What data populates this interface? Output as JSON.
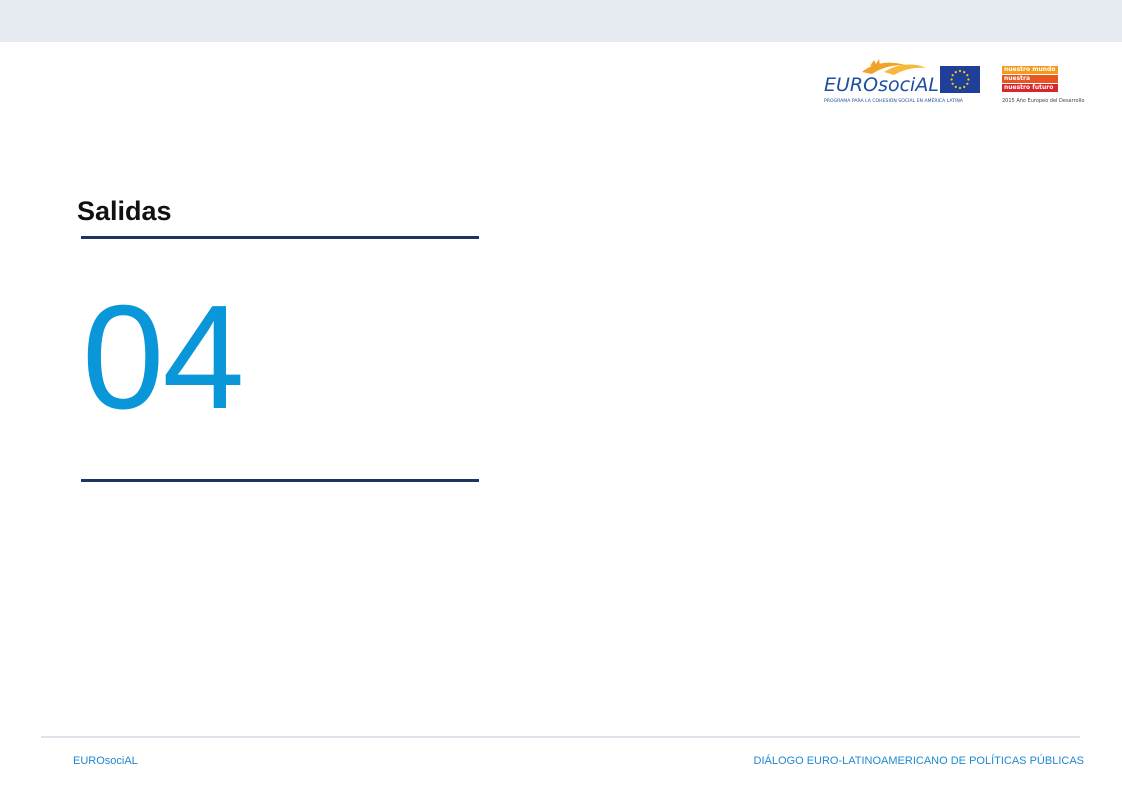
{
  "logos": {
    "eurosocial_text": "EUROsociAL",
    "eurosocial_tagline": "PROGRAMA PARA LA COHESIÓN SOCIAL EN AMÉRICA LATINA",
    "ey_lines": [
      "nuestro mundo",
      "nuestra dignidad",
      "nuestro futuro"
    ],
    "ey_colors": [
      "#f39a1f",
      "#e8541f",
      "#d8262c"
    ],
    "ey_caption": "2015 Año Europeo del Desarrollo",
    "eu_flag_color": "#1f3f99",
    "eu_star_color": "#ffcc00"
  },
  "section": {
    "title": "Salidas",
    "number": "04"
  },
  "footer": {
    "left": "EUROsociAL",
    "right": "DIÁLOGO EURO-LATINOAMERICANO DE POLÍTICAS PÚBLICAS"
  },
  "colors": {
    "top_band": "#e6ebf2",
    "rule": "#1f3264",
    "number": "#0a97d9",
    "footer_text": "#1e88cf"
  }
}
